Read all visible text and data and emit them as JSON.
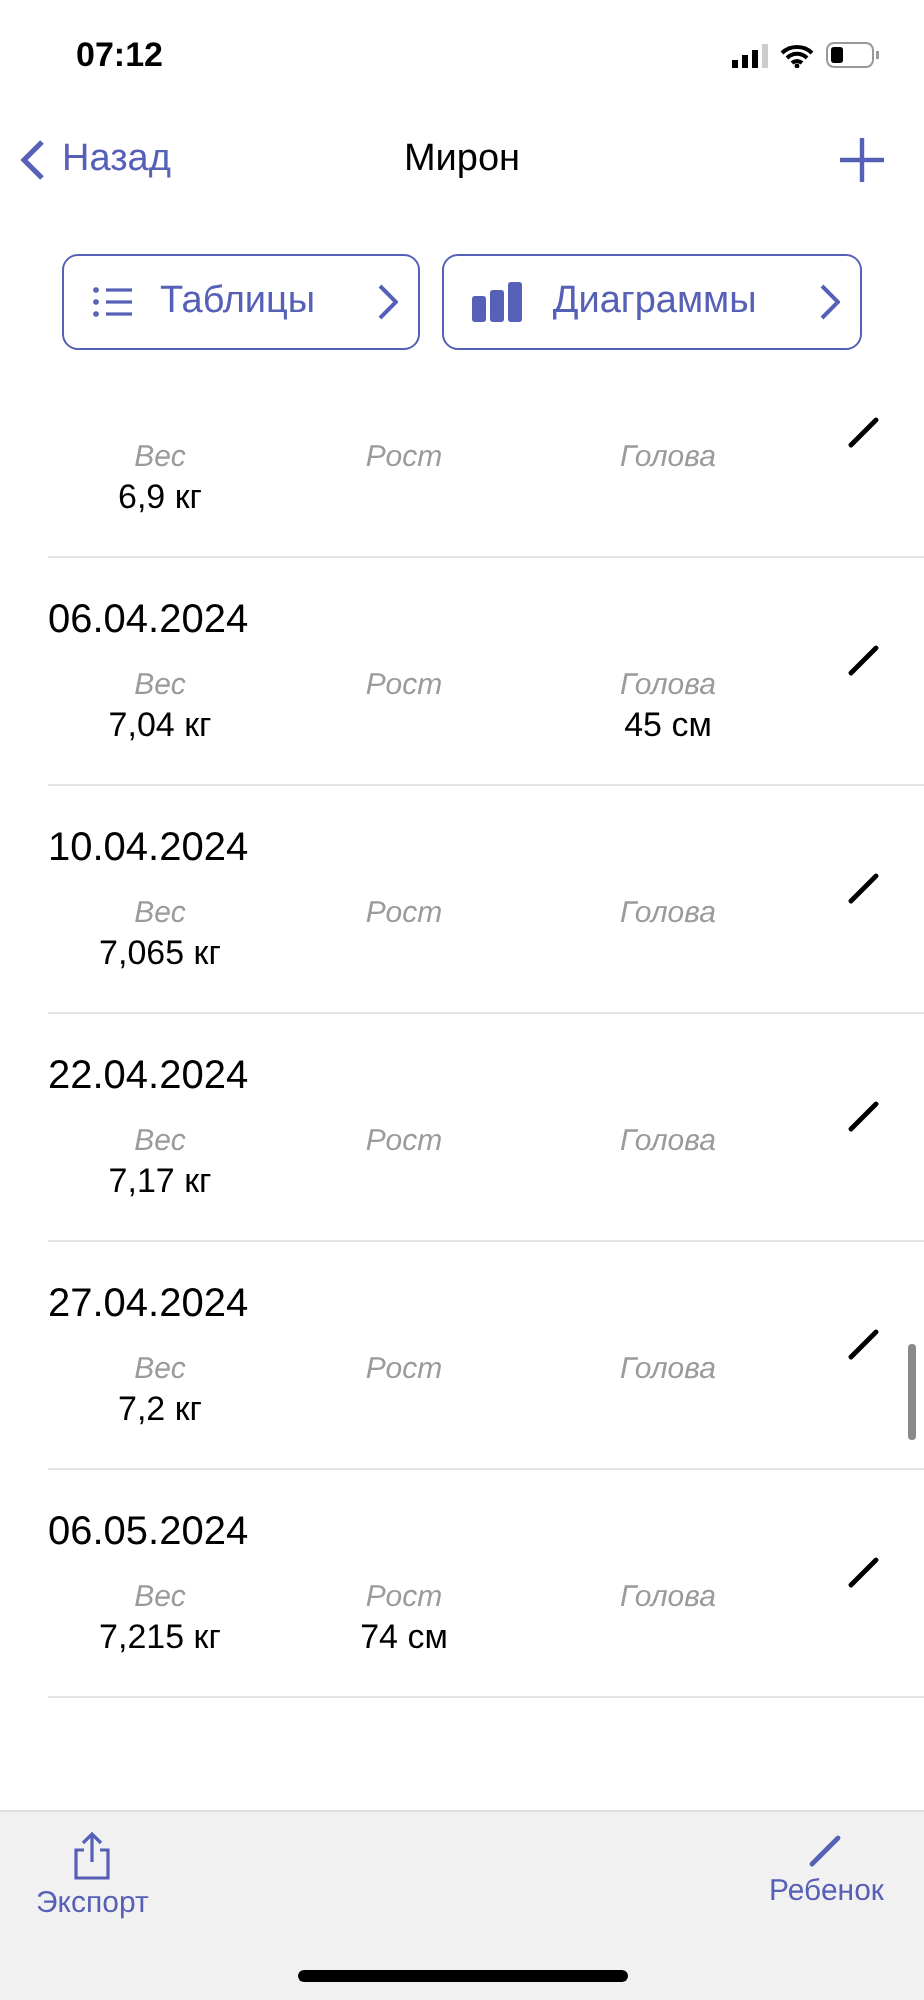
{
  "status_bar": {
    "time": "07:12"
  },
  "nav": {
    "back": "Назад",
    "title": "Мирон"
  },
  "shortcuts": [
    {
      "label": "Таблицы",
      "kind": "list"
    },
    {
      "label": "Диаграммы",
      "kind": "chart"
    }
  ],
  "entries": [
    {
      "metrics": [
        {
          "label": "Вес",
          "value": "6,9 кг"
        },
        {
          "label": "Рост"
        },
        {
          "label": "Голова"
        }
      ]
    },
    {
      "date": "06.04.2024",
      "metrics": [
        {
          "label": "Вес",
          "value": "7,04 кг"
        },
        {
          "label": "Рост"
        },
        {
          "label": "Голова",
          "value": "45 см"
        }
      ]
    },
    {
      "date": "10.04.2024",
      "metrics": [
        {
          "label": "Вес",
          "value": "7,065 кг"
        },
        {
          "label": "Рост"
        },
        {
          "label": "Голова"
        }
      ]
    },
    {
      "date": "22.04.2024",
      "metrics": [
        {
          "label": "Вес",
          "value": "7,17 кг"
        },
        {
          "label": "Рост"
        },
        {
          "label": "Голова"
        }
      ]
    },
    {
      "date": "27.04.2024",
      "metrics": [
        {
          "label": "Вес",
          "value": "7,2 кг"
        },
        {
          "label": "Рост"
        },
        {
          "label": "Голова"
        }
      ]
    },
    {
      "date": "06.05.2024",
      "metrics": [
        {
          "label": "Вес",
          "value": "7,215 кг"
        },
        {
          "label": "Рост",
          "value": "74 см"
        },
        {
          "label": "Голова"
        }
      ]
    }
  ],
  "toolbar": [
    {
      "label": "Экспорт",
      "kind": "share"
    },
    {
      "label": "Ребенок",
      "kind": "edit"
    }
  ]
}
